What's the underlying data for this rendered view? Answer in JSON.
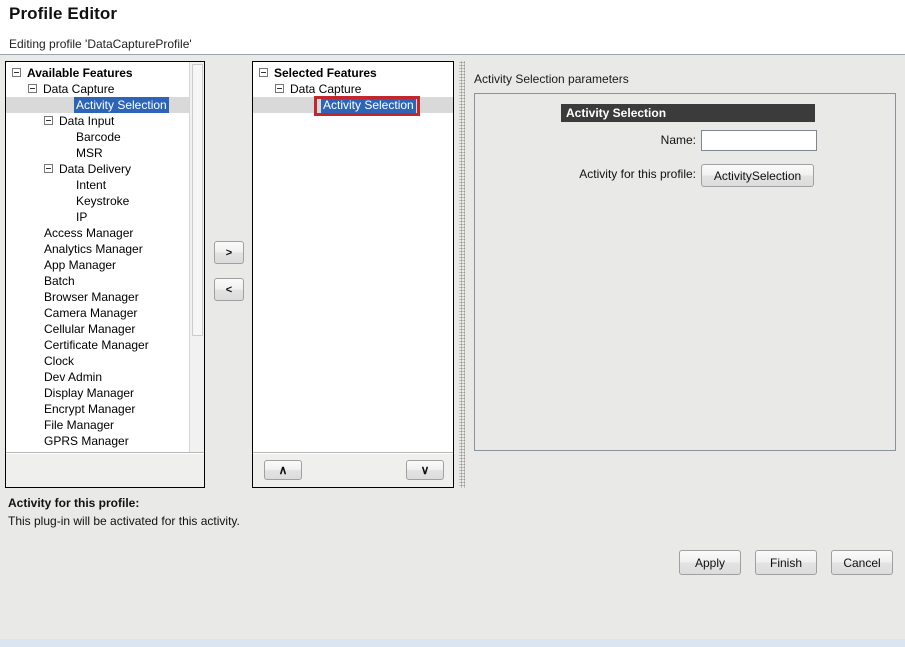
{
  "header": {
    "title": "Profile Editor",
    "subtitle": "Editing profile 'DataCaptureProfile'"
  },
  "available_features": {
    "root_label": "Available Features",
    "items": [
      {
        "label": "Available Features",
        "depth": 0,
        "expander": "minus",
        "bold": true,
        "selected": false
      },
      {
        "label": "Data Capture",
        "depth": 1,
        "expander": "minus",
        "bold": false,
        "selected": false
      },
      {
        "label": "Activity Selection",
        "depth": 3,
        "expander": "none",
        "bold": false,
        "selected": true
      },
      {
        "label": "Data Input",
        "depth": 2,
        "expander": "minus",
        "bold": false,
        "selected": false
      },
      {
        "label": "Barcode",
        "depth": 3,
        "expander": "none",
        "bold": false,
        "selected": false
      },
      {
        "label": "MSR",
        "depth": 3,
        "expander": "none",
        "bold": false,
        "selected": false
      },
      {
        "label": "Data Delivery",
        "depth": 2,
        "expander": "minus",
        "bold": false,
        "selected": false
      },
      {
        "label": "Intent",
        "depth": 3,
        "expander": "none",
        "bold": false,
        "selected": false
      },
      {
        "label": "Keystroke",
        "depth": 3,
        "expander": "none",
        "bold": false,
        "selected": false
      },
      {
        "label": "IP",
        "depth": 3,
        "expander": "none",
        "bold": false,
        "selected": false
      },
      {
        "label": "Access Manager",
        "depth": 1,
        "expander": "none",
        "bold": false,
        "selected": false
      },
      {
        "label": "Analytics Manager",
        "depth": 1,
        "expander": "none",
        "bold": false,
        "selected": false
      },
      {
        "label": "App Manager",
        "depth": 1,
        "expander": "none",
        "bold": false,
        "selected": false
      },
      {
        "label": "Batch",
        "depth": 1,
        "expander": "none",
        "bold": false,
        "selected": false
      },
      {
        "label": "Browser Manager",
        "depth": 1,
        "expander": "none",
        "bold": false,
        "selected": false
      },
      {
        "label": "Camera Manager",
        "depth": 1,
        "expander": "none",
        "bold": false,
        "selected": false
      },
      {
        "label": "Cellular Manager",
        "depth": 1,
        "expander": "none",
        "bold": false,
        "selected": false
      },
      {
        "label": "Certificate Manager",
        "depth": 1,
        "expander": "none",
        "bold": false,
        "selected": false
      },
      {
        "label": "Clock",
        "depth": 1,
        "expander": "none",
        "bold": false,
        "selected": false
      },
      {
        "label": "Dev Admin",
        "depth": 1,
        "expander": "none",
        "bold": false,
        "selected": false
      },
      {
        "label": "Display Manager",
        "depth": 1,
        "expander": "none",
        "bold": false,
        "selected": false
      },
      {
        "label": "Encrypt Manager",
        "depth": 1,
        "expander": "none",
        "bold": false,
        "selected": false
      },
      {
        "label": "File Manager",
        "depth": 1,
        "expander": "none",
        "bold": false,
        "selected": false
      },
      {
        "label": "GPRS Manager",
        "depth": 1,
        "expander": "none",
        "bold": false,
        "selected": false
      }
    ]
  },
  "transfer_buttons": {
    "add_label": ">",
    "remove_label": "<"
  },
  "selected_features": {
    "items": [
      {
        "label": "Selected Features",
        "depth": 0,
        "expander": "minus",
        "bold": true,
        "selected": false
      },
      {
        "label": "Data Capture",
        "depth": 1,
        "expander": "minus",
        "bold": false,
        "selected": false
      },
      {
        "label": "Activity Selection",
        "depth": 3,
        "expander": "none",
        "bold": false,
        "selected": true
      }
    ],
    "move_up_label": "∧",
    "move_down_label": "∨"
  },
  "parameters_panel": {
    "heading": "Activity Selection parameters",
    "group_title": "Activity Selection",
    "name_label": "Name:",
    "name_value": "",
    "name_placeholder": "",
    "activity_label": "Activity for this profile:",
    "activity_button_label": "ActivitySelection"
  },
  "help": {
    "title": "Activity for this profile:",
    "text": "This plug-in will be activated for this activity."
  },
  "footer": {
    "apply_label": "Apply",
    "finish_label": "Finish",
    "cancel_label": "Cancel"
  },
  "colors": {
    "selection_blue": "#2c64b8",
    "selection_row": "#d9d9d9",
    "annotation_red": "#c1272d",
    "group_header": "#3b3b3b",
    "window_bg": "#e9e9e7"
  }
}
